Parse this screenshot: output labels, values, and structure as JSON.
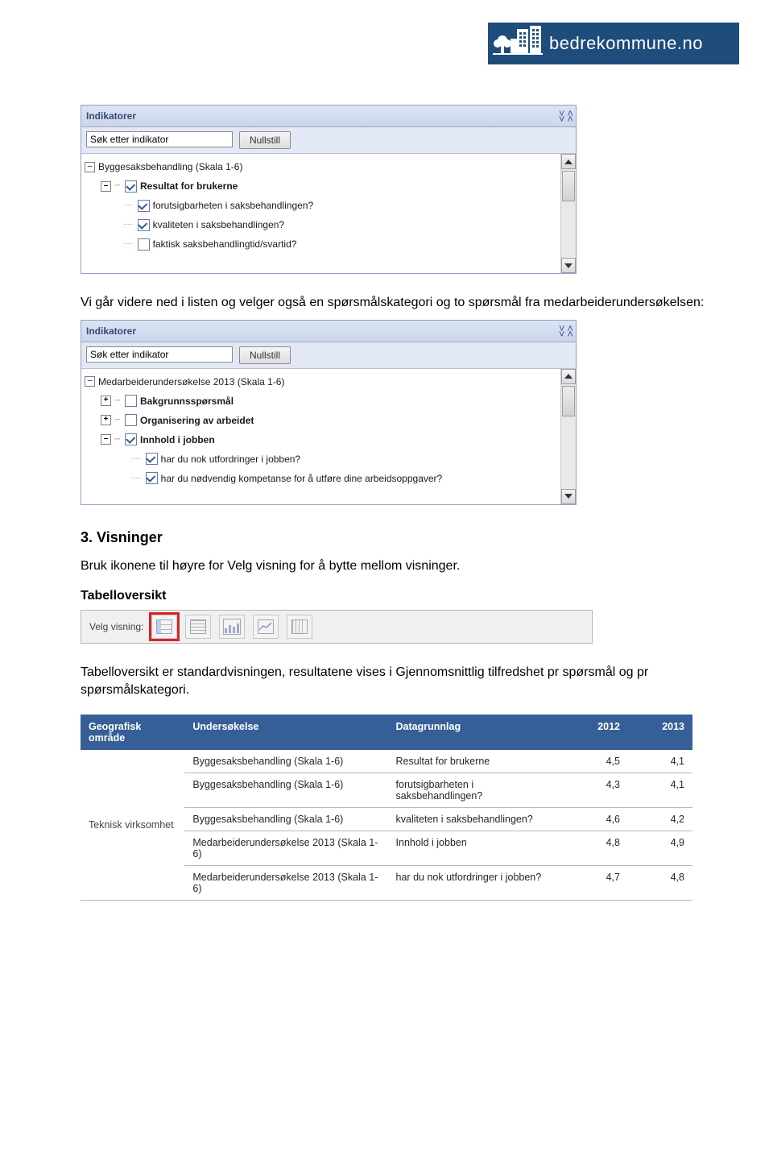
{
  "logo_text": "bedrekommune.no",
  "panel1": {
    "title": "Indikatorer",
    "search_placeholder": "Søk etter indikator",
    "reset": "Nullstill",
    "root": "Byggesaksbehandling (Skala 1-6)",
    "items": [
      {
        "label": "Resultat for brukerne",
        "checked": true,
        "bold": true
      },
      {
        "label": "forutsigbarheten i saksbehandlingen?",
        "checked": true,
        "bold": false
      },
      {
        "label": "kvaliteten i saksbehandlingen?",
        "checked": true,
        "bold": false
      },
      {
        "label": "faktisk saksbehandlingtid/svartid?",
        "checked": false,
        "bold": false
      }
    ]
  },
  "para1": "Vi går videre ned i listen og velger også en spørsmålskategori og to spørsmål fra medarbeiderundersøkelsen:",
  "panel2": {
    "title": "Indikatorer",
    "search_placeholder": "Søk etter indikator",
    "reset": "Nullstill",
    "root": "Medarbeiderundersøkelse 2013 (Skala 1-6)",
    "items": [
      {
        "pm": "+",
        "label": "Bakgrunnsspørsmål",
        "checked": false,
        "bold": true
      },
      {
        "pm": "+",
        "label": "Organisering av arbeidet",
        "checked": false,
        "bold": true
      },
      {
        "pm": "-",
        "label": "Innhold i jobben",
        "checked": true,
        "bold": true
      },
      {
        "pm": "",
        "label": "har du nok utfordringer i jobben?",
        "checked": true,
        "bold": false,
        "nested": true
      },
      {
        "pm": "",
        "label": "har du nødvendig kompetanse for å utføre dine arbeidsoppgaver?",
        "checked": true,
        "bold": false,
        "nested": true
      }
    ]
  },
  "h3": "3. Visninger",
  "para2": "Bruk ikonene til høyre for Velg visning for å bytte mellom visninger.",
  "h4": "Tabelloversikt",
  "view_label": "Velg visning:",
  "para3": "Tabelloversikt er standardvisningen, resultatene vises i Gjennomsnittlig tilfredshet pr spørsmål og pr spørsmålskategori.",
  "table": {
    "headers": [
      "Geografisk område",
      "Undersøkelse",
      "Datagrunnlag",
      "2012",
      "2013"
    ],
    "first_col_span": "Teknisk virksomhet",
    "rows": [
      [
        "Byggesaksbehandling (Skala 1-6)",
        "Resultat for brukerne",
        "4,5",
        "4,1"
      ],
      [
        "Byggesaksbehandling (Skala 1-6)",
        "forutsigbarheten i saksbehandlingen?",
        "4,3",
        "4,1"
      ],
      [
        "Byggesaksbehandling (Skala 1-6)",
        "kvaliteten i saksbehandlingen?",
        "4,6",
        "4,2"
      ],
      [
        "Medarbeiderundersøkelse 2013 (Skala 1-6)",
        "Innhold i jobben",
        "4,8",
        "4,9"
      ],
      [
        "Medarbeiderundersøkelse 2013 (Skala 1-6)",
        "har du nok utfordringer i jobben?",
        "4,7",
        "4,8"
      ]
    ]
  }
}
